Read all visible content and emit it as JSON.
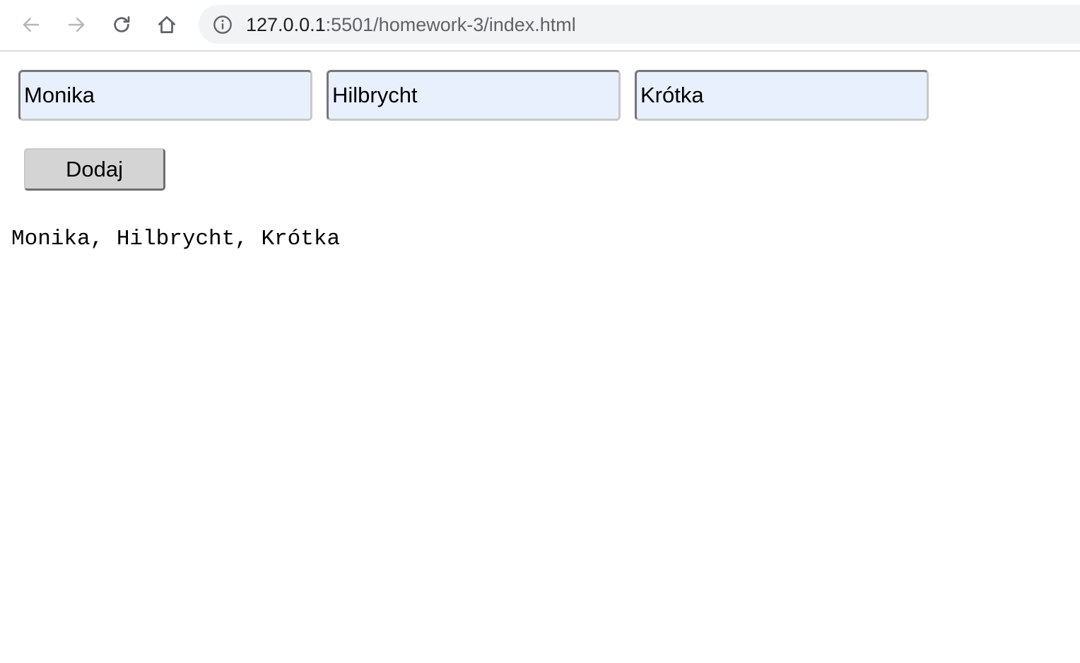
{
  "browser": {
    "url_host": "127.0.0.1",
    "url_rest": ":5501/homework-3/index.html",
    "icons": {
      "back": "arrow-left-icon",
      "forward": "arrow-right-icon",
      "reload": "reload-icon",
      "home": "home-icon",
      "site_info": "info-icon"
    }
  },
  "form": {
    "first_name": "Monika",
    "last_name": "Hilbrycht",
    "nickname": "Krótka",
    "add_button_label": "Dodaj"
  },
  "output": {
    "text": "Monika, Hilbrycht, Krótka"
  },
  "colors": {
    "input_background": "#e8f0fe",
    "button_background": "#d4d4d4",
    "omnibox_background": "#f1f3f4"
  }
}
